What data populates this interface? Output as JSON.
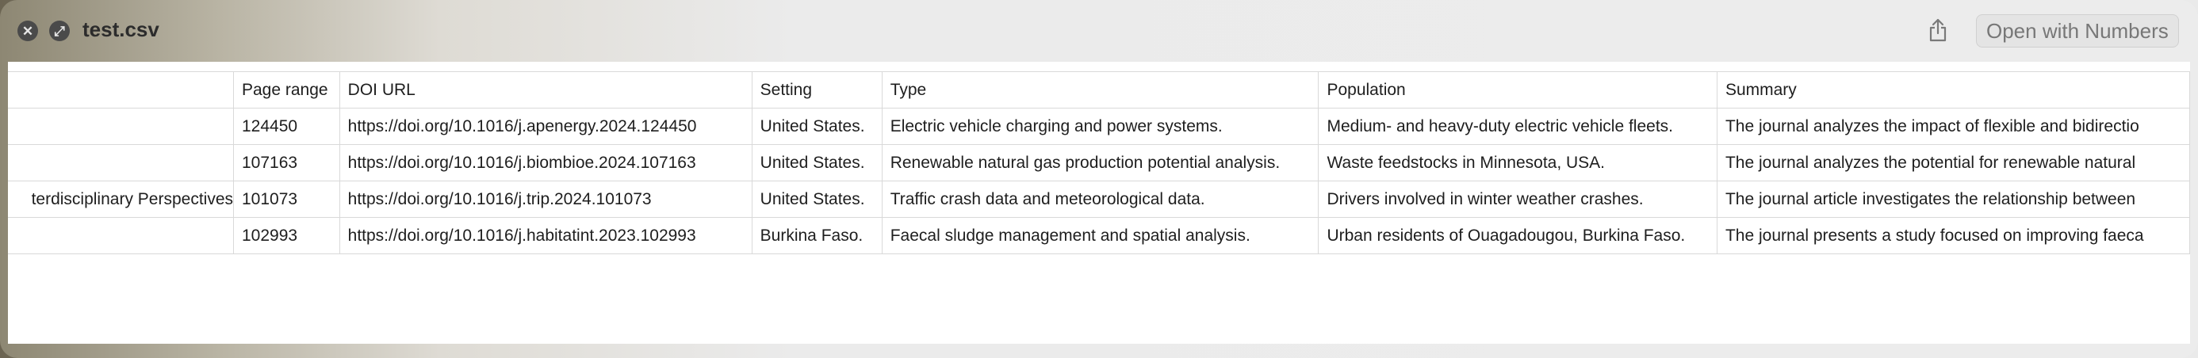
{
  "window": {
    "title": "test.csv",
    "open_button_label": "Open with Numbers",
    "close_icon": "close-icon",
    "fullscreen_icon": "expand-icon",
    "share_icon": "share-icon"
  },
  "table": {
    "headers": [
      "",
      "Page range",
      "DOI URL",
      "Setting",
      "Type",
      "Population",
      "Summary"
    ],
    "rows": [
      [
        "",
        "124450",
        "https://doi.org/10.1016/j.apenergy.2024.124450",
        "United States.",
        "Electric vehicle charging and power systems.",
        "Medium- and heavy-duty electric vehicle fleets.",
        "The journal analyzes the impact of flexible and bidirectio"
      ],
      [
        "",
        "107163",
        "https://doi.org/10.1016/j.biombioe.2024.107163",
        "United States.",
        "Renewable natural gas production potential analysis.",
        "Waste feedstocks in Minnesota, USA.",
        "The journal analyzes the potential for renewable natural"
      ],
      [
        "terdisciplinary Perspectives",
        "101073",
        "https://doi.org/10.1016/j.trip.2024.101073",
        "United States.",
        "Traffic crash data and meteorological data.",
        "Drivers involved in winter weather crashes.",
        "The journal article investigates the relationship between"
      ],
      [
        "",
        "102993",
        "https://doi.org/10.1016/j.habitatint.2023.102993",
        "Burkina Faso.",
        "Faecal sludge management and spatial analysis.",
        "Urban residents of Ouagadougou, Burkina Faso.",
        "The journal presents a study focused on improving faeca"
      ]
    ]
  }
}
